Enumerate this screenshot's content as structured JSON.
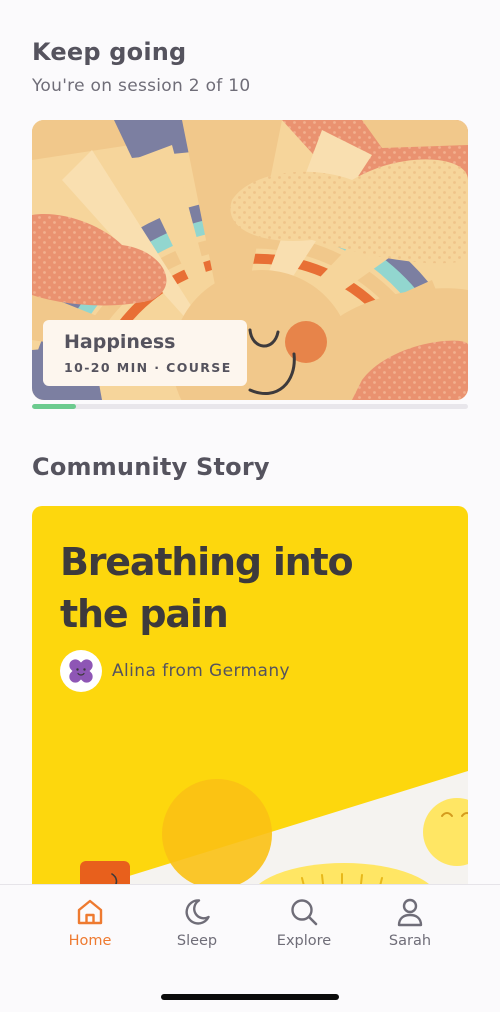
{
  "keep_going": {
    "title": "Keep going",
    "subtitle": "You're on session 2 of 10",
    "course": {
      "title": "Happiness",
      "meta": "10-20 MIN · COURSE",
      "progress": 0.1
    }
  },
  "community_story": {
    "title": "Community Story",
    "story": {
      "headline": "Breathing into the pain",
      "author": "Alina from Germany"
    }
  },
  "tabs": [
    {
      "label": "Home",
      "icon": "home-icon",
      "active": true
    },
    {
      "label": "Sleep",
      "icon": "moon-icon",
      "active": false
    },
    {
      "label": "Explore",
      "icon": "search-icon",
      "active": false
    },
    {
      "label": "Sarah",
      "icon": "profile-icon",
      "active": false
    }
  ],
  "colors": {
    "accent": "#ee7a30",
    "progress": "#6ccb8f",
    "story_background": "#fdd70d",
    "text": "#55535e"
  }
}
